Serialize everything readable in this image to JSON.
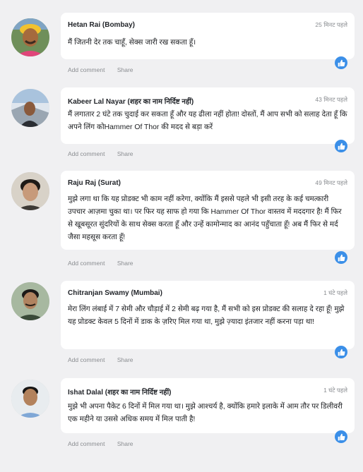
{
  "icons": {
    "like": "thumbs-up-icon",
    "avatar": "user-avatar"
  },
  "colors": {
    "background": "#f0f0f2",
    "bubble": "#ffffff",
    "like": "#3b8fe8",
    "meta": "#8a8d91"
  },
  "comments": [
    {
      "name": "Hetan Rai (Bombay)",
      "time": "25 मिनट पहले",
      "text": "मैं जितनी देर तक चाहूँ, सेक्स जारी रख सकता हूँ।",
      "add_comment": "Add comment",
      "share": "Share"
    },
    {
      "name": "Kabeer Lal Nayar (शहर का नाम निर्दिष्ट नहीं)",
      "time": "43 मिनट पहले",
      "text": "मैं लगातार 2 घंटे तक चुदाई कर सकता हूँ और यह ढीला नहीं होता! दोस्तों, मैं आप सभी को सलाह देता हूँ कि अपने लिंग कोHammer Of Thor की मदद से बड़ा करें",
      "add_comment": "Add comment",
      "share": "Share"
    },
    {
      "name": "Raju Raj (Surat)",
      "time": "49 मिनट पहले",
      "text": "मुझे लगा था कि यह प्रोडक्ट भी काम नहीं करेगा, क्योंकि मैं इससे पहले भी इसी तरह के कई चमत्कारी उपचार आज़मा चुका था। पर फिर यह साफ हो गया कि Hammer Of Thor वास्तव में मददगार है! मैं फिर से खूबसूरत सुंदरियों के साथ सेक्स करता हूँ और उन्हें कामोन्माद का आनंद पहुँचाता हूँ! अब मैं फिर से मर्द जैसा महसूस करता हूँ!",
      "add_comment": "Add comment",
      "share": "Share"
    },
    {
      "name": "Chitranjan Swamy (Mumbai)",
      "time": "1 घंटे पहले",
      "text": "मेरा लिंग लंबाई में 7 सेमी और चौड़ाई में 2 सेमी बढ़ गया है, मैं सभी को इस प्रोडक्ट की सलाह दे रहा हूँ! मुझे यह प्रोडक्ट केवल 5 दिनों में डाक के ज़रिए मिल गया था, मुझे ज़्यादा इंतजार नहीं करना पड़ा था!",
      "add_comment": "Add comment",
      "share": "Share"
    },
    {
      "name": "Ishat Dalal (शहर का नाम निर्दिष्ट नहीं)",
      "time": "1 घंटे पहले",
      "text": "मुझे भी अपना पैकेट 6 दिनों में मिल गया था। मुझे आश्चर्य है, क्योंकि हमारे इलाके में आम तौर पर डिलीवरी एक महीने या उससे अधिक समय में मिल पाती है!",
      "add_comment": "Add comment",
      "share": "Share"
    }
  ]
}
